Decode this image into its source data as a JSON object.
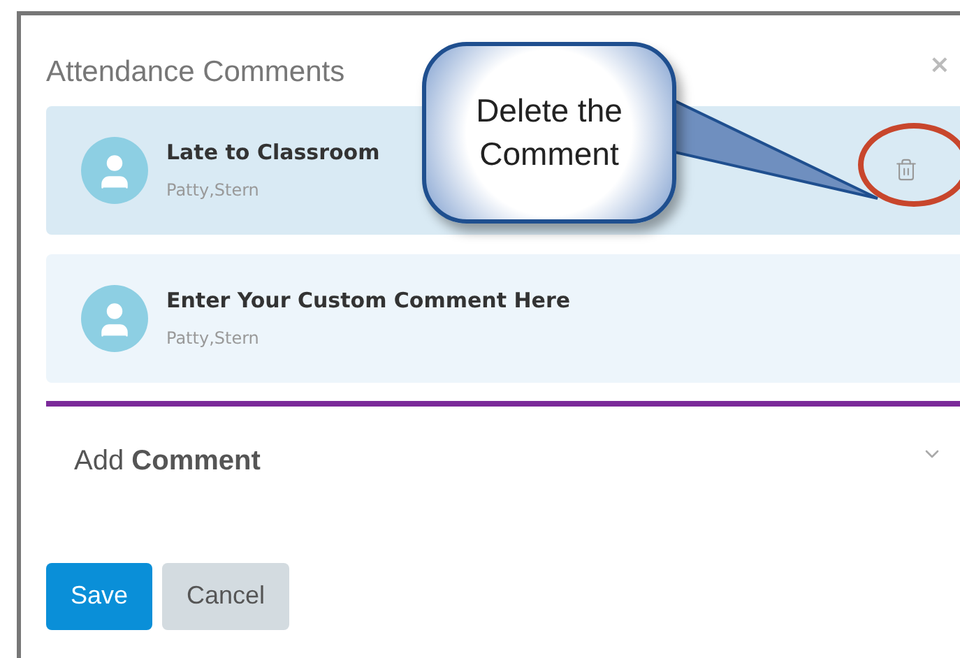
{
  "dialog": {
    "title": "Attendance Comments",
    "close": "×"
  },
  "comments": [
    {
      "text": "Late to Classroom",
      "author": "Patty,Stern",
      "highlighted": true
    },
    {
      "text": "Enter Your Custom Comment Here",
      "author": "Patty,Stern",
      "highlighted": false
    }
  ],
  "add_comment": {
    "label": "Add **Comment**",
    "expanded": false
  },
  "buttons": [
    {
      "label": "Save",
      "kind": "primary"
    },
    {
      "label": "Cancel",
      "kind": "secondary"
    }
  ],
  "callout": {
    "text": "Delete the Comment"
  }
}
